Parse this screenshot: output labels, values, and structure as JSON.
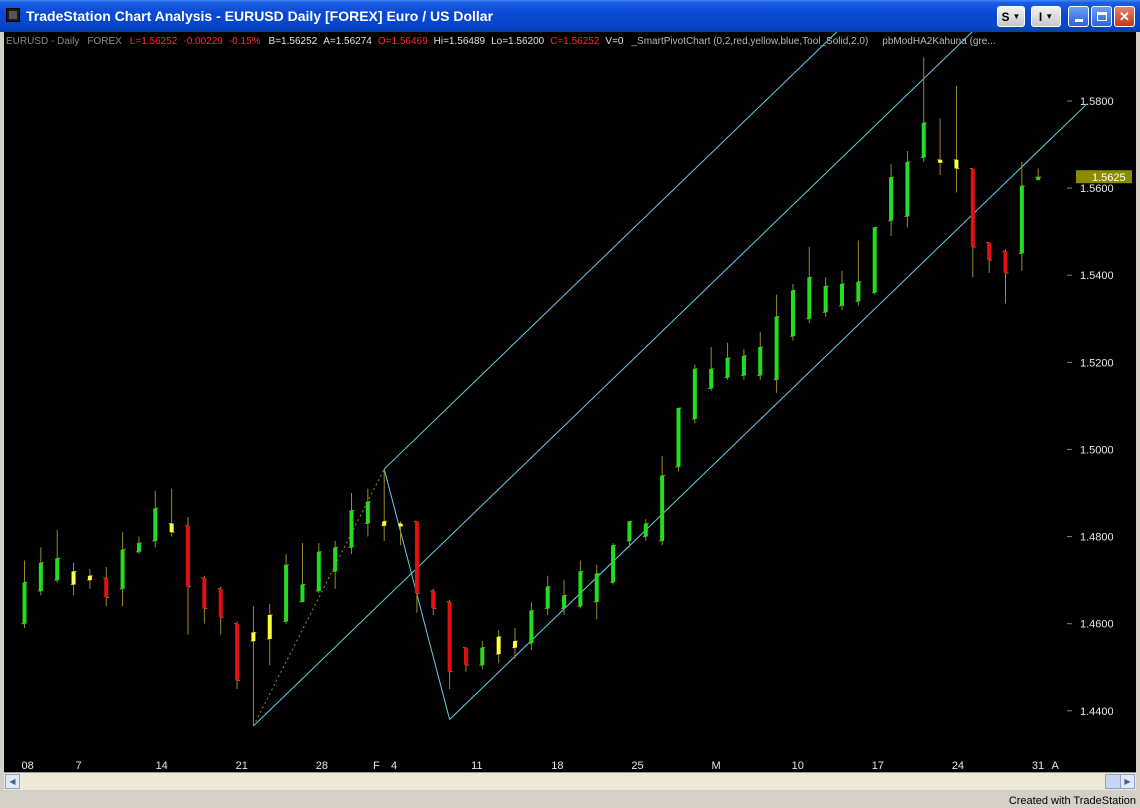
{
  "window": {
    "title": "TradeStation Chart Analysis - EURUSD  Daily  [FOREX] Euro / US Dollar",
    "buttons": {
      "style": "S",
      "tool": "I"
    }
  },
  "header": {
    "symbol": "EURUSD - Daily",
    "exchange": "FOREX",
    "last": "L=1.56252",
    "change": "-0.00229",
    "change_pct": "-0.15%",
    "bid": "B=1.56252",
    "ask": "A=1.56274",
    "open": "O=1.56469",
    "high": "Hi=1.56489",
    "low": "Lo=1.56200",
    "close": "C=1.56252",
    "volume": "V=0",
    "indicator1": "_SmartPivotChart  (0,2,red,yellow,blue,Tool_Solid,2,0)",
    "indicator2": "pbModHA2Kahuna  (gre...",
    "colors": {
      "label": "#8a8a8a",
      "red": "#ff2a2a",
      "white": "#e0e0e0"
    }
  },
  "footer": {
    "credit": "Created with TradeStation"
  },
  "chart_data": {
    "type": "candlestick",
    "instrument": "EURUSD - Daily",
    "ylim": [
      1.4333,
      1.5917
    ],
    "y_ticks": [
      1.44,
      1.46,
      1.48,
      1.5,
      1.52,
      1.54,
      1.56,
      1.58
    ],
    "y_tick_labels": [
      "1.4400",
      "1.4600",
      "1.4800",
      "1.5000",
      "1.5200",
      "1.5400",
      "1.5600",
      "1.5800"
    ],
    "last_price_label": "1.5625",
    "last_price": 1.5625,
    "x_tick_labels": [
      {
        "label": "08",
        "bar": 0
      },
      {
        "label": "7",
        "bar": 3.3
      },
      {
        "label": "14",
        "bar": 8.2
      },
      {
        "label": "21",
        "bar": 13.1
      },
      {
        "label": "28",
        "bar": 18.0
      },
      {
        "label": "F",
        "bar": 21.5
      },
      {
        "label": "4",
        "bar": 22.6
      },
      {
        "label": "11",
        "bar": 27.5
      },
      {
        "label": "18",
        "bar": 32.4
      },
      {
        "label": "25",
        "bar": 37.3
      },
      {
        "label": "M",
        "bar": 42.2
      },
      {
        "label": "10",
        "bar": 47.1
      },
      {
        "label": "17",
        "bar": 52.0
      },
      {
        "label": "24",
        "bar": 56.9
      },
      {
        "label": "31",
        "bar": 61.8
      },
      {
        "label": "A",
        "bar": 63.0
      }
    ],
    "body_colors": {
      "green": "#22dd22",
      "red": "#e01010",
      "yellow": "#ffff44"
    },
    "wick_color": "#9a8a2a",
    "channel_color": "#66cfe6",
    "pivot_line_color": "#9a8a2a",
    "bars": [
      {
        "hi": 1.4745,
        "lo": 1.459,
        "o": 1.46,
        "c": 1.4695,
        "col": "green"
      },
      {
        "hi": 1.4775,
        "lo": 1.4665,
        "o": 1.4675,
        "c": 1.474,
        "col": "green"
      },
      {
        "hi": 1.4815,
        "lo": 1.4695,
        "o": 1.47,
        "c": 1.475,
        "col": "green"
      },
      {
        "hi": 1.474,
        "lo": 1.4665,
        "o": 1.469,
        "c": 1.472,
        "col": "yellow"
      },
      {
        "hi": 1.4725,
        "lo": 1.468,
        "o": 1.47,
        "c": 1.471,
        "col": "yellow"
      },
      {
        "hi": 1.473,
        "lo": 1.464,
        "o": 1.4705,
        "c": 1.466,
        "col": "red"
      },
      {
        "hi": 1.481,
        "lo": 1.464,
        "o": 1.468,
        "c": 1.477,
        "col": "green"
      },
      {
        "hi": 1.48,
        "lo": 1.476,
        "o": 1.4765,
        "c": 1.4785,
        "col": "green"
      },
      {
        "hi": 1.4905,
        "lo": 1.4775,
        "o": 1.479,
        "c": 1.4865,
        "col": "green"
      },
      {
        "hi": 1.491,
        "lo": 1.48,
        "o": 1.483,
        "c": 1.481,
        "col": "yellow"
      },
      {
        "hi": 1.4845,
        "lo": 1.4575,
        "o": 1.4825,
        "c": 1.4685,
        "col": "red"
      },
      {
        "hi": 1.471,
        "lo": 1.46,
        "o": 1.4705,
        "c": 1.4635,
        "col": "red"
      },
      {
        "hi": 1.4685,
        "lo": 1.4575,
        "o": 1.468,
        "c": 1.4615,
        "col": "red"
      },
      {
        "hi": 1.4605,
        "lo": 1.445,
        "o": 1.46,
        "c": 1.447,
        "col": "red"
      },
      {
        "hi": 1.464,
        "lo": 1.4365,
        "o": 1.456,
        "c": 1.458,
        "col": "yellow"
      },
      {
        "hi": 1.4645,
        "lo": 1.4505,
        "o": 1.4565,
        "c": 1.462,
        "col": "yellow"
      },
      {
        "hi": 1.476,
        "lo": 1.46,
        "o": 1.4605,
        "c": 1.4735,
        "col": "green"
      },
      {
        "hi": 1.4785,
        "lo": 1.465,
        "o": 1.465,
        "c": 1.469,
        "col": "green"
      },
      {
        "hi": 1.4785,
        "lo": 1.467,
        "o": 1.4675,
        "c": 1.4765,
        "col": "green"
      },
      {
        "hi": 1.479,
        "lo": 1.468,
        "o": 1.472,
        "c": 1.4775,
        "col": "green"
      },
      {
        "hi": 1.49,
        "lo": 1.476,
        "o": 1.4775,
        "c": 1.486,
        "col": "green"
      },
      {
        "hi": 1.491,
        "lo": 1.48,
        "o": 1.483,
        "c": 1.488,
        "col": "green"
      },
      {
        "hi": 1.4955,
        "lo": 1.479,
        "o": 1.4825,
        "c": 1.4835,
        "col": "yellow"
      },
      {
        "hi": 1.4835,
        "lo": 1.478,
        "o": 1.483,
        "c": 1.4825,
        "col": "yellow"
      },
      {
        "hi": 1.4835,
        "lo": 1.4625,
        "o": 1.4835,
        "c": 1.467,
        "col": "red"
      },
      {
        "hi": 1.468,
        "lo": 1.462,
        "o": 1.4675,
        "c": 1.4635,
        "col": "red"
      },
      {
        "hi": 1.4655,
        "lo": 1.445,
        "o": 1.465,
        "c": 1.449,
        "col": "red"
      },
      {
        "hi": 1.4545,
        "lo": 1.449,
        "o": 1.4545,
        "c": 1.4505,
        "col": "red"
      },
      {
        "hi": 1.456,
        "lo": 1.4495,
        "o": 1.4505,
        "c": 1.4545,
        "col": "green"
      },
      {
        "hi": 1.4585,
        "lo": 1.451,
        "o": 1.453,
        "c": 1.457,
        "col": "yellow"
      },
      {
        "hi": 1.459,
        "lo": 1.452,
        "o": 1.4545,
        "c": 1.456,
        "col": "yellow"
      },
      {
        "hi": 1.465,
        "lo": 1.454,
        "o": 1.4555,
        "c": 1.463,
        "col": "green"
      },
      {
        "hi": 1.471,
        "lo": 1.462,
        "o": 1.4635,
        "c": 1.4685,
        "col": "green"
      },
      {
        "hi": 1.47,
        "lo": 1.462,
        "o": 1.4635,
        "c": 1.4665,
        "col": "green"
      },
      {
        "hi": 1.4745,
        "lo": 1.4635,
        "o": 1.464,
        "c": 1.472,
        "col": "green"
      },
      {
        "hi": 1.4735,
        "lo": 1.461,
        "o": 1.465,
        "c": 1.4715,
        "col": "green"
      },
      {
        "hi": 1.4785,
        "lo": 1.469,
        "o": 1.4695,
        "c": 1.478,
        "col": "green"
      },
      {
        "hi": 1.4835,
        "lo": 1.4775,
        "o": 1.479,
        "c": 1.4835,
        "col": "green"
      },
      {
        "hi": 1.484,
        "lo": 1.479,
        "o": 1.48,
        "c": 1.483,
        "col": "green"
      },
      {
        "hi": 1.4985,
        "lo": 1.478,
        "o": 1.479,
        "c": 1.494,
        "col": "green"
      },
      {
        "hi": 1.504,
        "lo": 1.495,
        "o": 1.496,
        "c": 1.5095,
        "col": "green"
      },
      {
        "hi": 1.5195,
        "lo": 1.506,
        "o": 1.507,
        "c": 1.5185,
        "col": "green"
      },
      {
        "hi": 1.5235,
        "lo": 1.5135,
        "o": 1.514,
        "c": 1.5185,
        "col": "green"
      },
      {
        "hi": 1.5245,
        "lo": 1.516,
        "o": 1.5165,
        "c": 1.521,
        "col": "green"
      },
      {
        "hi": 1.523,
        "lo": 1.516,
        "o": 1.517,
        "c": 1.5215,
        "col": "green"
      },
      {
        "hi": 1.527,
        "lo": 1.516,
        "o": 1.517,
        "c": 1.5235,
        "col": "green"
      },
      {
        "hi": 1.5355,
        "lo": 1.513,
        "o": 1.516,
        "c": 1.5305,
        "col": "green"
      },
      {
        "hi": 1.538,
        "lo": 1.525,
        "o": 1.526,
        "c": 1.5365,
        "col": "green"
      },
      {
        "hi": 1.5465,
        "lo": 1.529,
        "o": 1.53,
        "c": 1.5395,
        "col": "green"
      },
      {
        "hi": 1.5395,
        "lo": 1.5305,
        "o": 1.5315,
        "c": 1.5375,
        "col": "green"
      },
      {
        "hi": 1.541,
        "lo": 1.532,
        "o": 1.533,
        "c": 1.538,
        "col": "green"
      },
      {
        "hi": 1.548,
        "lo": 1.533,
        "o": 1.534,
        "c": 1.5385,
        "col": "green"
      },
      {
        "hi": 1.55,
        "lo": 1.5355,
        "o": 1.536,
        "c": 1.551,
        "col": "green"
      },
      {
        "hi": 1.5655,
        "lo": 1.549,
        "o": 1.5525,
        "c": 1.5625,
        "col": "green"
      },
      {
        "hi": 1.5685,
        "lo": 1.551,
        "o": 1.5535,
        "c": 1.566,
        "col": "green"
      },
      {
        "hi": 1.59,
        "lo": 1.566,
        "o": 1.567,
        "c": 1.575,
        "col": "green"
      },
      {
        "hi": 1.576,
        "lo": 1.563,
        "o": 1.5665,
        "c": 1.566,
        "col": "yellow"
      },
      {
        "hi": 1.5835,
        "lo": 1.559,
        "o": 1.5665,
        "c": 1.5645,
        "col": "yellow"
      },
      {
        "hi": 1.5645,
        "lo": 1.5395,
        "o": 1.5645,
        "c": 1.5465,
        "col": "red"
      },
      {
        "hi": 1.5475,
        "lo": 1.5405,
        "o": 1.5475,
        "c": 1.5435,
        "col": "red"
      },
      {
        "hi": 1.546,
        "lo": 1.5335,
        "o": 1.5455,
        "c": 1.5405,
        "col": "red"
      },
      {
        "hi": 1.566,
        "lo": 1.541,
        "o": 1.545,
        "c": 1.5605,
        "col": "green"
      },
      {
        "hi": 1.5645,
        "lo": 1.562,
        "o": 1.5625,
        "c": 1.5625,
        "col": "green"
      }
    ],
    "pivot_zigzag": [
      {
        "bar": 14,
        "price": 1.4365
      },
      {
        "bar": 22,
        "price": 1.4955
      },
      {
        "bar": 26,
        "price": 1.438
      }
    ],
    "channel": {
      "anchor_top": {
        "bar": 22,
        "price": 1.4955
      },
      "anchor_bottom": {
        "bar": 26,
        "price": 1.438
      },
      "median_start": {
        "bar": 14,
        "price": 1.4365
      },
      "slope_per_bar": 0.003625,
      "end_bar": 65
    }
  }
}
